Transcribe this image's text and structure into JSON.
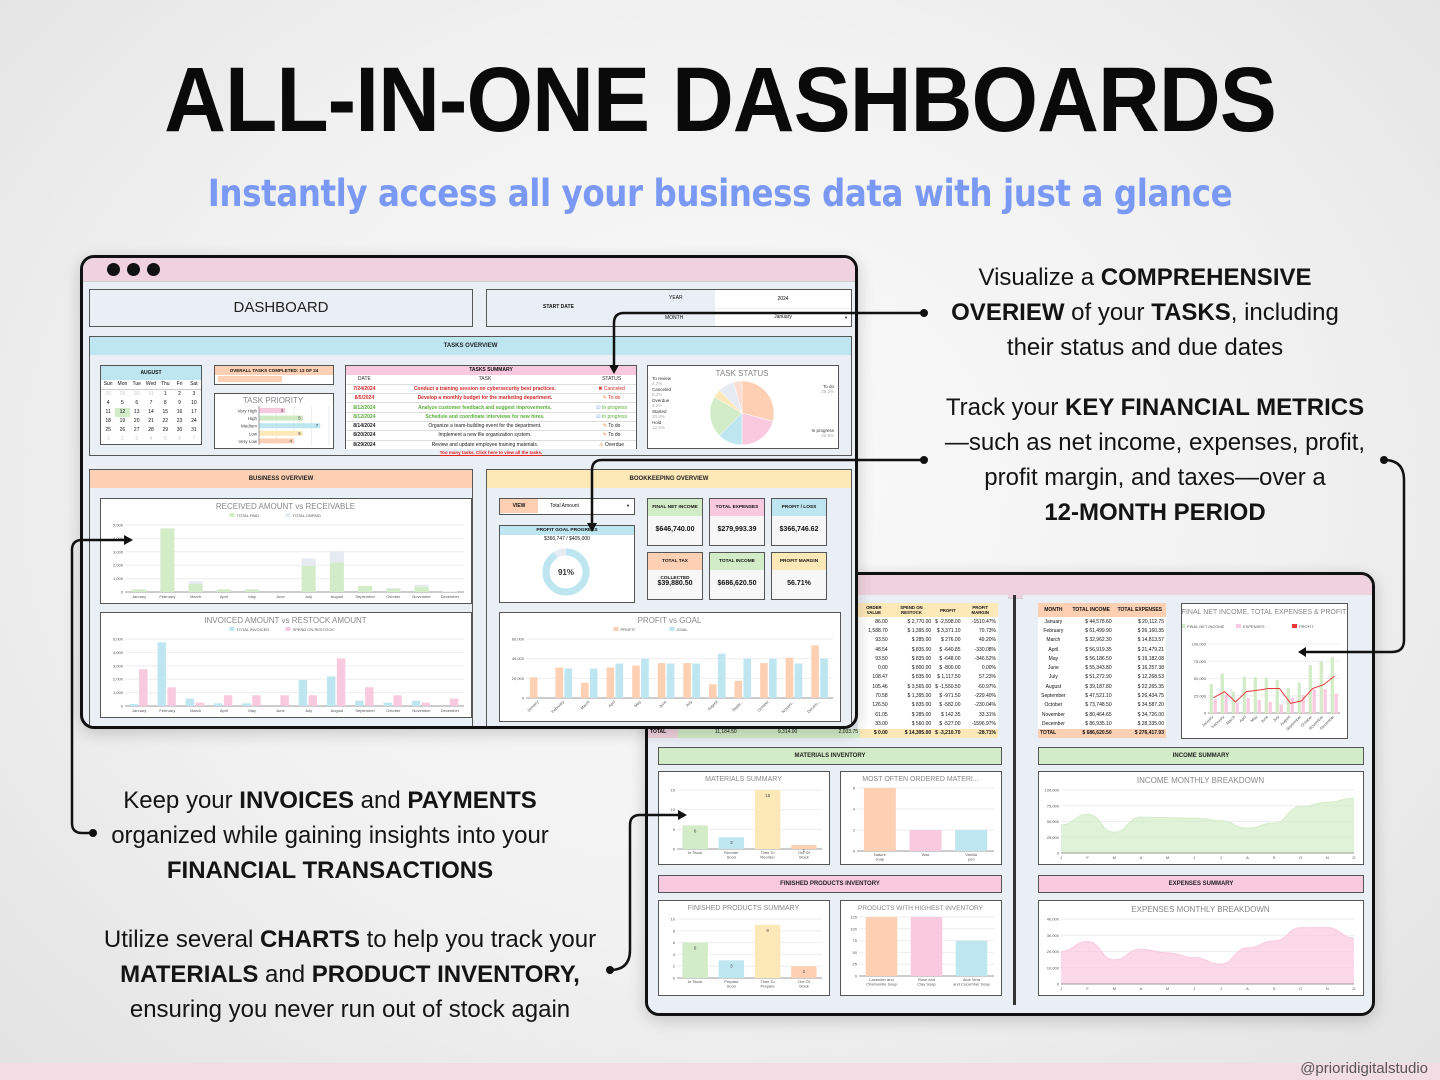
{
  "hero": {
    "title": "ALL-IN-ONE DASHBOARDS",
    "subtitle": "Instantly access all your business data with just a glance"
  },
  "callouts": {
    "tasks": [
      [
        {
          "t": "Visualize a ",
          "b": false
        },
        {
          "t": "COMPREHENSIVE",
          "b": true
        }
      ],
      [
        {
          "t": "OVERIEW",
          "b": true
        },
        {
          "t": " of your ",
          "b": false
        },
        {
          "t": "TASKS",
          "b": true
        },
        {
          "t": ", including",
          "b": false
        }
      ],
      [
        {
          "t": "their status and due dates",
          "b": false
        }
      ]
    ],
    "finance": [
      [
        {
          "t": "Track your ",
          "b": false
        },
        {
          "t": "KEY FINANCIAL METRICS",
          "b": true
        }
      ],
      [
        {
          "t": "—such as net income, expenses, profit,",
          "b": false
        }
      ],
      [
        {
          "t": "profit margin, and taxes—over a",
          "b": false
        }
      ],
      [
        {
          "t": "12-MONTH PERIOD",
          "b": true
        }
      ]
    ],
    "invoices": [
      [
        {
          "t": "Keep your ",
          "b": false
        },
        {
          "t": "INVOICES",
          "b": true
        },
        {
          "t": " and ",
          "b": false
        },
        {
          "t": "PAYMENTS",
          "b": true
        }
      ],
      [
        {
          "t": "organized while gaining insights into your",
          "b": false
        }
      ],
      [
        {
          "t": "FINANCIAL TRANSACTIONS",
          "b": true
        }
      ]
    ],
    "charts": [
      [
        {
          "t": "Utilize several ",
          "b": false
        },
        {
          "t": "CHARTS",
          "b": true
        },
        {
          "t": " to help you track your",
          "b": false
        }
      ],
      [
        {
          "t": "MATERIALS",
          "b": true
        },
        {
          "t": " and ",
          "b": false
        },
        {
          "t": "PRODUCT INVENTORY,",
          "b": true
        }
      ],
      [
        {
          "t": "ensuring you never run out of stock again",
          "b": false
        }
      ]
    ]
  },
  "credit": "@prioridigitalstudio",
  "dashboard": {
    "title": "DASHBOARD",
    "start_date_label": "START DATE",
    "year_label": "YEAR",
    "year_value": "2024",
    "month_label": "MONTH",
    "month_value": "January",
    "tasks_overview": "TASKS OVERVIEW",
    "calendar": {
      "month": "AUGUST",
      "weekdays": [
        "Sun",
        "Mon",
        "Tue",
        "Wed",
        "Thu",
        "Fri",
        "Sat"
      ],
      "weeks": [
        [
          "28",
          "29",
          "30",
          "31",
          "1",
          "2",
          "3"
        ],
        [
          "4",
          "5",
          "6",
          "7",
          "8",
          "9",
          "10"
        ],
        [
          "11",
          "12",
          "13",
          "14",
          "15",
          "16",
          "17"
        ],
        [
          "18",
          "19",
          "20",
          "21",
          "22",
          "23",
          "24"
        ],
        [
          "25",
          "26",
          "27",
          "28",
          "29",
          "30",
          "31"
        ],
        [
          "1",
          "2",
          "3",
          "4",
          "5",
          "6",
          "7"
        ]
      ],
      "today": "12"
    },
    "overall_completed": "OVERALL TASKS COMPLETED: 13 OF 24",
    "overall_fraction": 0.54,
    "task_priority": {
      "title": "TASK PRIORITY",
      "categories": [
        "Very High",
        "High",
        "Medium",
        "Low",
        "Very Low"
      ],
      "values": [
        3,
        5,
        7,
        5,
        4
      ],
      "colors": [
        "#f8c8de",
        "#cfe9c4",
        "#bde6f1",
        "#fde8b8",
        "#fcd0b4"
      ]
    },
    "tasks_summary": {
      "title": "TASKS SUMMARY",
      "headers": [
        "DATE",
        "TASK",
        "STATUS"
      ],
      "rows": [
        {
          "date": "7/24/2024",
          "task": "Conduct a training session on cybersecurity best practices.",
          "status": "Canceled",
          "color": "#d42a2a",
          "icon": "✖"
        },
        {
          "date": "8/5/2024",
          "task": "Develop a monthly budget for the marketing department.",
          "status": "To do",
          "color": "#d42a2a",
          "icon": "✎"
        },
        {
          "date": "8/12/2024",
          "task": "Analyze customer feedback and suggest improvements.",
          "status": "In progress",
          "color": "#5aae3a",
          "icon": "☑"
        },
        {
          "date": "8/12/2024",
          "task": "Schedule and coordinate interviews for new hires.",
          "status": "In progress",
          "color": "#5aae3a",
          "icon": "☑"
        },
        {
          "date": "8/14/2024",
          "task": "Organize a team-building event for the department.",
          "status": "To do",
          "color": "#222",
          "icon": "✎"
        },
        {
          "date": "8/20/2024",
          "task": "Implement a new file organization system.",
          "status": "To do",
          "color": "#222",
          "icon": "✎"
        },
        {
          "date": "8/29/2024",
          "task": "Review and update employee training materials.",
          "status": "Overdue",
          "color": "#222",
          "icon": "⚠"
        }
      ],
      "link": "Too many tasks. Click here to view all the tasks."
    },
    "task_status": {
      "title": "TASK STATUS",
      "slices": [
        {
          "label": "To do",
          "pct": 29.2,
          "color": "#fdd0b4"
        },
        {
          "label": "In progress",
          "pct": 20.8,
          "color": "#f9c9e0"
        },
        {
          "label": "Hold",
          "pct": 12.5,
          "color": "#bde6f1"
        },
        {
          "label": "Started",
          "pct": 20.8,
          "color": "#d3ecc8"
        },
        {
          "label": "Overdue",
          "pct": 4.2,
          "color": "#fde8b8"
        },
        {
          "label": "Canceled",
          "pct": 8.3,
          "color": "#e6ebf2"
        },
        {
          "label": "To review",
          "pct": 4.2,
          "color": "#fbdcd0"
        }
      ]
    },
    "business_overview": "BUSINESS OVERVIEW",
    "bookkeeping_overview": "BOOKKEEPING OVERVIEW",
    "view_label": "VIEW",
    "view_value": "Total Amount",
    "profit_goal": {
      "title": "PROFIT GOAL PROGRESS",
      "text": "$366,747 / $405,000",
      "percent_label": "91%",
      "fraction": 0.91
    },
    "kpis": [
      {
        "label": "FINAL NET INCOME",
        "value": "$646,740.00",
        "color": "#d3ecc8"
      },
      {
        "label": "TOTAL EXPENSES",
        "value": "$279,993.39",
        "color": "#f9c9e0"
      },
      {
        "label": "PROFIT / LOSS",
        "value": "$366,746.62",
        "color": "#bde6f1"
      },
      {
        "label": "TOTAL TAX COLLECTED",
        "value": "$39,880.50",
        "color": "#fdd0b4"
      },
      {
        "label": "TOTAL INCOME",
        "value": "$686,620.50",
        "color": "#d3ecc8"
      },
      {
        "label": "PROFIT MARGIN",
        "value": "56.71%",
        "color": "#fde8b8"
      }
    ]
  },
  "dashboard2": {
    "restock_table": {
      "headers": [
        "ORDER VALUE",
        "SPEND ON RESTOCK",
        "PROFIT",
        "PROFIT MARGIN"
      ],
      "rows": [
        [
          "86.00",
          "2,770.00",
          "-2,598.00",
          "-1510.47%"
        ],
        [
          "1,588.70",
          "1,395.00",
          "3,371.10",
          "70.73%"
        ],
        [
          "93.50",
          "285.00",
          "276.00",
          "49.20%"
        ],
        [
          "48.54",
          "835.00",
          "-640.85",
          "-330.08%"
        ],
        [
          "93.50",
          "835.00",
          "-648.00",
          "-346.52%"
        ],
        [
          "0.00",
          "800.00",
          "-800.00",
          "0.00%"
        ],
        [
          "108.47",
          "835.00",
          "1,117.50",
          "57.23%"
        ],
        [
          "105.46",
          "3,565.00",
          "-1,550.50",
          "-60.97%"
        ],
        [
          "70.58",
          "1,395.00",
          "-971.50",
          "-229.40%"
        ],
        [
          "126.50",
          "835.00",
          "-582.00",
          "-230.04%"
        ],
        [
          "61.05",
          "285.00",
          "142.35",
          "33.31%"
        ],
        [
          "33.00",
          "560.00",
          "-527.00",
          "-1596.97%"
        ]
      ],
      "total": [
        "0.00",
        "14,395.00",
        "-3,210.70",
        "-28.71%"
      ],
      "left_total_label": "TOTAL",
      "left_totals": [
        "11,184.50",
        "9,314.00",
        "2,033.75"
      ]
    },
    "income_table": {
      "headers": [
        "MONTH",
        "TOTAL INCOME",
        "TOTAL EXPENSES"
      ],
      "rows": [
        [
          "January",
          "44,578.60",
          "20,112.75"
        ],
        [
          "February",
          "61,499.90",
          "26,160.35"
        ],
        [
          "March",
          "32,962.30",
          "14,813.57"
        ],
        [
          "April",
          "56,919.35",
          "21,479.21"
        ],
        [
          "May",
          "56,186.50",
          "19,182.08"
        ],
        [
          "June",
          "55,343.80",
          "16,257.38"
        ],
        [
          "July",
          "51,272.90",
          "12,268.53"
        ],
        [
          "August",
          "39,187.80",
          "22,265.35"
        ],
        [
          "September",
          "47,521.10",
          "26,434.75"
        ],
        [
          "October",
          "73,748.50",
          "34,587.20"
        ],
        [
          "November",
          "80,464.65",
          "34,726.00"
        ],
        [
          "December",
          "86,935.10",
          "28,335.00"
        ]
      ],
      "total_label": "TOTAL",
      "totals": [
        "686,620.50",
        "276,417.93"
      ]
    },
    "materials_inventory": "MATERIALS INVENTORY",
    "finished_products_inventory": "FINISHED PRODUCTS INVENTORY",
    "income_summary": "INCOME SUMMARY",
    "expenses_summary": "EXPENSES SUMMARY"
  },
  "chart_data": [
    {
      "id": "received",
      "type": "bar",
      "title": "RECEIVED AMOUNT vs RECEIVABLE",
      "stacked": true,
      "categories": [
        "January",
        "February",
        "March",
        "April",
        "May",
        "June",
        "July",
        "August",
        "September",
        "October",
        "November",
        "December"
      ],
      "series": [
        {
          "name": "TOTAL PAID",
          "color": "#d3ecc8",
          "values": [
            200,
            4750,
            600,
            200,
            200,
            0,
            1950,
            2200,
            450,
            250,
            400,
            0
          ]
        },
        {
          "name": "TOTAL UNPAID",
          "color": "#e6ebf2",
          "values": [
            0,
            0,
            200,
            0,
            0,
            0,
            550,
            850,
            0,
            50,
            150,
            50
          ]
        }
      ],
      "ylim": [
        0,
        5000
      ],
      "yticks": [
        0,
        1000,
        2000,
        3000,
        4000,
        5000
      ],
      "legend": "top"
    },
    {
      "id": "invoiced",
      "type": "bar",
      "title": "INVOICED AMOUNT vs RESTOCK AMOUNT",
      "categories": [
        "January",
        "February",
        "March",
        "April",
        "May",
        "June",
        "July",
        "August",
        "September",
        "October",
        "November",
        "December"
      ],
      "series": [
        {
          "name": "TOTAL INVOICED",
          "color": "#bde6f1",
          "values": [
            150,
            4750,
            550,
            200,
            200,
            0,
            1950,
            2200,
            400,
            250,
            400,
            0
          ]
        },
        {
          "name": "SPEND ON RESTOCK",
          "color": "#f9c9e0",
          "values": [
            2750,
            1400,
            250,
            800,
            800,
            800,
            800,
            3550,
            1400,
            800,
            250,
            550
          ]
        }
      ],
      "ylim": [
        0,
        5000
      ],
      "yticks": [
        0,
        1000,
        2000,
        3000,
        4000,
        5000
      ],
      "legend": "top"
    },
    {
      "id": "profitgoal",
      "type": "bar",
      "title": "PROFIT vs GOAL",
      "categories": [
        "January",
        "February",
        "March",
        "April",
        "May",
        "June",
        "July",
        "August",
        "Septe...",
        "October",
        "Novem...",
        "Decem..."
      ],
      "series": [
        {
          "name": "PROFIT",
          "color": "#fdd0b4",
          "values": [
            21000,
            31000,
            15500,
            31000,
            33000,
            35500,
            35500,
            14000,
            17500,
            35500,
            41000,
            53500
          ]
        },
        {
          "name": "GOAL",
          "color": "#bde6f1",
          "values": [
            0,
            30000,
            30000,
            35000,
            40000,
            35000,
            35000,
            45000,
            40000,
            40000,
            35000,
            40000
          ]
        }
      ],
      "ylim": [
        0,
        60000
      ],
      "yticks": [
        0,
        20000,
        40000,
        60000
      ],
      "legend": "top"
    },
    {
      "id": "netincome",
      "type": "bar+line",
      "title": "FINAL NET INCOME, TOTAL EXPENSES & PROFIT",
      "categories": [
        "January",
        "February",
        "March",
        "April",
        "May",
        "June",
        "July",
        "August",
        "September",
        "October",
        "November",
        "December"
      ],
      "series": [
        {
          "name": "FINAL NET INCOME",
          "color": "#d3ecc8",
          "values": [
            42000,
            57000,
            31000,
            52500,
            52000,
            51500,
            47500,
            36500,
            44000,
            69500,
            75000,
            81000
          ]
        },
        {
          "name": "EXPENSES",
          "color": "#f9c9e0",
          "values": [
            20000,
            26000,
            14800,
            21500,
            19000,
            16000,
            12300,
            22000,
            26000,
            34500,
            34700,
            28300
          ]
        },
        {
          "name": "PROFIT",
          "color": "#e83a3a",
          "line": true,
          "values": [
            22000,
            31000,
            16000,
            31000,
            33000,
            35500,
            35500,
            14000,
            17500,
            35500,
            41000,
            53500
          ]
        }
      ],
      "ylim": [
        0,
        100000
      ],
      "yticks": [
        0,
        25000,
        50000,
        75000,
        100000
      ],
      "legend": "top"
    },
    {
      "id": "materials",
      "type": "bar",
      "title": "MATERIALS SUMMARY",
      "categories": [
        "In Stock",
        "Reorder Soon",
        "Time To Reorder",
        "Out Of Stock"
      ],
      "values": [
        6,
        3,
        15,
        1
      ],
      "colors": [
        "#d3ecc8",
        "#bde6f1",
        "#fde8b8",
        "#fdd0b4"
      ],
      "ylim": [
        0,
        15
      ],
      "yticks": [
        0,
        5,
        10,
        15
      ],
      "data_labels": true
    },
    {
      "id": "mostordered",
      "type": "bar",
      "title": "MOST OFTEN ORDERED MATERI...",
      "categories": [
        "Nature soap",
        "Wax",
        "Vanilla pod"
      ],
      "values": [
        6,
        2,
        2
      ],
      "colors": [
        "#fdd0b4",
        "#f9c9e0",
        "#bde6f1"
      ],
      "ylim": [
        0,
        6
      ],
      "yticks": [
        0,
        2,
        4,
        6
      ]
    },
    {
      "id": "finished",
      "type": "bar",
      "title": "FINISHED PRODUCTS SUMMARY",
      "categories": [
        "In Stock",
        "Prepare Soon",
        "Time To Prepare",
        "Out Of Stock"
      ],
      "values": [
        6,
        3,
        9,
        2
      ],
      "colors": [
        "#d3ecc8",
        "#bde6f1",
        "#fde8b8",
        "#fdd0b4"
      ],
      "ylim": [
        0,
        10
      ],
      "yticks": [
        0,
        2,
        4,
        6,
        8,
        10
      ],
      "data_labels": true
    },
    {
      "id": "highestinv",
      "type": "bar",
      "title": "PRODUCTS WITH HIGHEST INVENTORY",
      "categories": [
        "Lavender and Chamomile Soap",
        "Rose and Clay Soap",
        "Aloe Vera and Cucumber Soap"
      ],
      "values": [
        125,
        125,
        75
      ],
      "colors": [
        "#fdd0b4",
        "#f9c9e0",
        "#bde6f1"
      ],
      "ylim": [
        0,
        125
      ],
      "yticks": [
        0,
        25,
        50,
        75,
        100,
        125
      ]
    },
    {
      "id": "incomebreak",
      "type": "area",
      "title": "INCOME MONTHLY BREAKDOWN",
      "categories": [
        "J",
        "F",
        "M",
        "A",
        "M",
        "J",
        "J",
        "A",
        "S",
        "O",
        "N",
        "D"
      ],
      "values": [
        44578.6,
        61499.9,
        32962.3,
        56919.35,
        56186.5,
        55343.8,
        51272.9,
        39187.8,
        47521.1,
        73748.5,
        80464.65,
        86935.1
      ],
      "color": "#d3ecc8",
      "ylim": [
        0,
        100000
      ],
      "yticks": [
        0,
        25000,
        50000,
        75000,
        100000
      ]
    },
    {
      "id": "expensesbreak",
      "type": "area",
      "title": "EXPENSES MONTHLY BREAKDOWN",
      "categories": [
        "J",
        "F",
        "M",
        "A",
        "M",
        "J",
        "J",
        "A",
        "S",
        "O",
        "N",
        "D"
      ],
      "values": [
        20112.75,
        26160.35,
        14813.57,
        21479.21,
        19182.08,
        16257.38,
        12268.53,
        22265.35,
        26434.75,
        34587.2,
        34726,
        28335
      ],
      "color": "#f9c9e0",
      "ylim": [
        0,
        40000
      ],
      "yticks": [
        0,
        10000,
        20000,
        30000,
        40000
      ]
    }
  ]
}
